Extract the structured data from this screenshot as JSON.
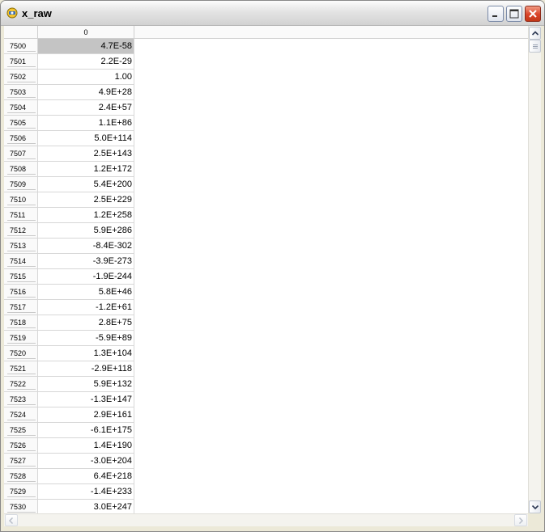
{
  "window": {
    "title": "x_raw"
  },
  "grid": {
    "column_header": "0",
    "selected_row": "7500",
    "rows": [
      {
        "index": "7500",
        "value": "4.7E-58"
      },
      {
        "index": "7501",
        "value": "2.2E-29"
      },
      {
        "index": "7502",
        "value": "1.00"
      },
      {
        "index": "7503",
        "value": "4.9E+28"
      },
      {
        "index": "7504",
        "value": "2.4E+57"
      },
      {
        "index": "7505",
        "value": "1.1E+86"
      },
      {
        "index": "7506",
        "value": "5.0E+114"
      },
      {
        "index": "7507",
        "value": "2.5E+143"
      },
      {
        "index": "7508",
        "value": "1.2E+172"
      },
      {
        "index": "7509",
        "value": "5.4E+200"
      },
      {
        "index": "7510",
        "value": "2.5E+229"
      },
      {
        "index": "7511",
        "value": "1.2E+258"
      },
      {
        "index": "7512",
        "value": "5.9E+286"
      },
      {
        "index": "7513",
        "value": "-8.4E-302"
      },
      {
        "index": "7514",
        "value": "-3.9E-273"
      },
      {
        "index": "7515",
        "value": "-1.9E-244"
      },
      {
        "index": "7516",
        "value": "5.8E+46"
      },
      {
        "index": "7517",
        "value": "-1.2E+61"
      },
      {
        "index": "7518",
        "value": "2.8E+75"
      },
      {
        "index": "7519",
        "value": "-5.9E+89"
      },
      {
        "index": "7520",
        "value": "1.3E+104"
      },
      {
        "index": "7521",
        "value": "-2.9E+118"
      },
      {
        "index": "7522",
        "value": "5.9E+132"
      },
      {
        "index": "7523",
        "value": "-1.3E+147"
      },
      {
        "index": "7524",
        "value": "2.9E+161"
      },
      {
        "index": "7525",
        "value": "-6.1E+175"
      },
      {
        "index": "7526",
        "value": "1.4E+190"
      },
      {
        "index": "7527",
        "value": "-3.0E+204"
      },
      {
        "index": "7528",
        "value": "6.4E+218"
      },
      {
        "index": "7529",
        "value": "-1.4E+233"
      },
      {
        "index": "7530",
        "value": "3.0E+247"
      }
    ]
  },
  "icons": {
    "app": "app-icon",
    "minimize": "minimize-icon",
    "maximize": "maximize-icon",
    "close": "close-icon",
    "scroll_up": "chevron-up-icon",
    "scroll_down": "chevron-down-icon",
    "scroll_left": "chevron-left-icon",
    "scroll_right": "chevron-right-icon"
  },
  "colors": {
    "selection": "#c4c4c4",
    "close_button": "#d9442a"
  }
}
